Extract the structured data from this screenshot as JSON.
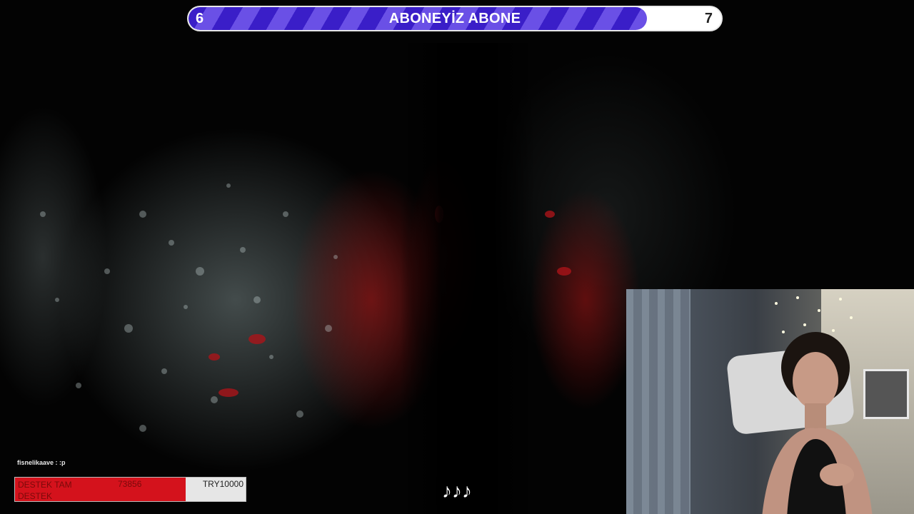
{
  "goal": {
    "start_value": "6",
    "title": "ABONEYİZ ABONE",
    "end_value": "7",
    "progress": 0.86,
    "fill_color": "#3a1ec8",
    "fill_stripe_color": "#6a50e6"
  },
  "chat": {
    "message": "fisnelikaave : :p"
  },
  "donation": {
    "label_line1": "DESTEK TAM",
    "label_line2": "DESTEK",
    "current": "73856",
    "target": "TRY10000",
    "fill_color": "#d4121c"
  },
  "music": {
    "icon": "music-notes-icon",
    "glyph": "♪♪♪"
  },
  "webcam": {
    "description_icon": "webcam-feed"
  }
}
